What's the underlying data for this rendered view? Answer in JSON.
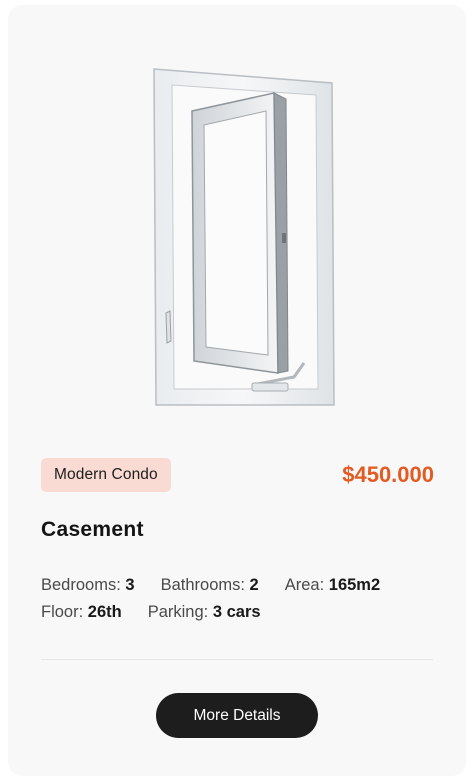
{
  "listing": {
    "badge": "Modern Condo",
    "price": "$450.000",
    "title": "Casement",
    "specs": {
      "bedrooms_label": "Bedrooms:",
      "bedrooms_value": "3",
      "bathrooms_label": "Bathrooms:",
      "bathrooms_value": "2",
      "area_label": "Area:",
      "area_value": "165m2",
      "floor_label": "Floor:",
      "floor_value": "26th",
      "parking_label": "Parking:",
      "parking_value": "3 cars"
    },
    "cta_label": "More Details"
  },
  "colors": {
    "card_bg": "#f8f8f8",
    "badge_bg": "#fadbd3",
    "price": "#e35a23",
    "cta_bg": "#1d1d1d"
  }
}
